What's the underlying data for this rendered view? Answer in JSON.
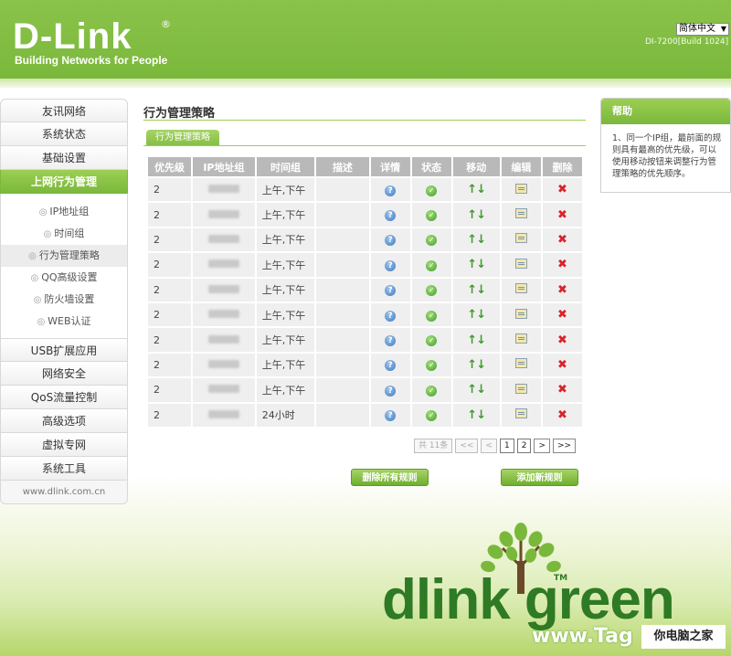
{
  "header": {
    "logo": "D-Link",
    "logo_reg": "®",
    "tagline": "Building Networks for People",
    "language": "简体中文",
    "build": "DI-7200[Build 1024]"
  },
  "sidebar": {
    "items_top": [
      {
        "label": "友讯网络"
      },
      {
        "label": "系统状态"
      },
      {
        "label": "基础设置"
      },
      {
        "label": "上网行为管理"
      }
    ],
    "sub_items": [
      {
        "label": "IP地址组"
      },
      {
        "label": "时间组"
      },
      {
        "label": "行为管理策略"
      },
      {
        "label": "QQ高级设置"
      },
      {
        "label": "防火墙设置"
      },
      {
        "label": "WEB认证"
      }
    ],
    "items_bottom": [
      {
        "label": "USB扩展应用"
      },
      {
        "label": "网络安全"
      },
      {
        "label": "QoS流量控制"
      },
      {
        "label": "高级选项"
      },
      {
        "label": "虚拟专网"
      },
      {
        "label": "系统工具"
      }
    ],
    "footer": "www.dlink.com.cn"
  },
  "main": {
    "title": "行为管理策略",
    "tab": "行为管理策略",
    "columns": [
      "优先级",
      "IP地址组",
      "时间组",
      "描述",
      "详情",
      "状态",
      "移动",
      "编辑",
      "删除"
    ],
    "rows": [
      {
        "priority": "2",
        "time": "上午,下午"
      },
      {
        "priority": "2",
        "time": "上午,下午"
      },
      {
        "priority": "2",
        "time": "上午,下午"
      },
      {
        "priority": "2",
        "time": "上午,下午"
      },
      {
        "priority": "2",
        "time": "上午,下午"
      },
      {
        "priority": "2",
        "time": "上午,下午"
      },
      {
        "priority": "2",
        "time": "上午,下午"
      },
      {
        "priority": "2",
        "time": "上午,下午"
      },
      {
        "priority": "2",
        "time": "上午,下午"
      },
      {
        "priority": "2",
        "time": "24小时"
      }
    ],
    "pager": {
      "total": "共 11条",
      "first": "<<",
      "prev": "<",
      "page1": "1",
      "page2": "2",
      "next": ">",
      "last": ">>"
    },
    "delete_all": "删除所有规则",
    "add_rule": "添加新规则"
  },
  "help": {
    "title": "帮助",
    "text": "1、同一个IP组，最前面的规则具有最高的优先级，可以使用移动按钮来调整行为管理策略的优先顺序。"
  },
  "footer_logo": {
    "text": "dlink green",
    "tm": "TM"
  },
  "watermark": {
    "site": "www.Tag",
    "box": "你电脑之家"
  }
}
